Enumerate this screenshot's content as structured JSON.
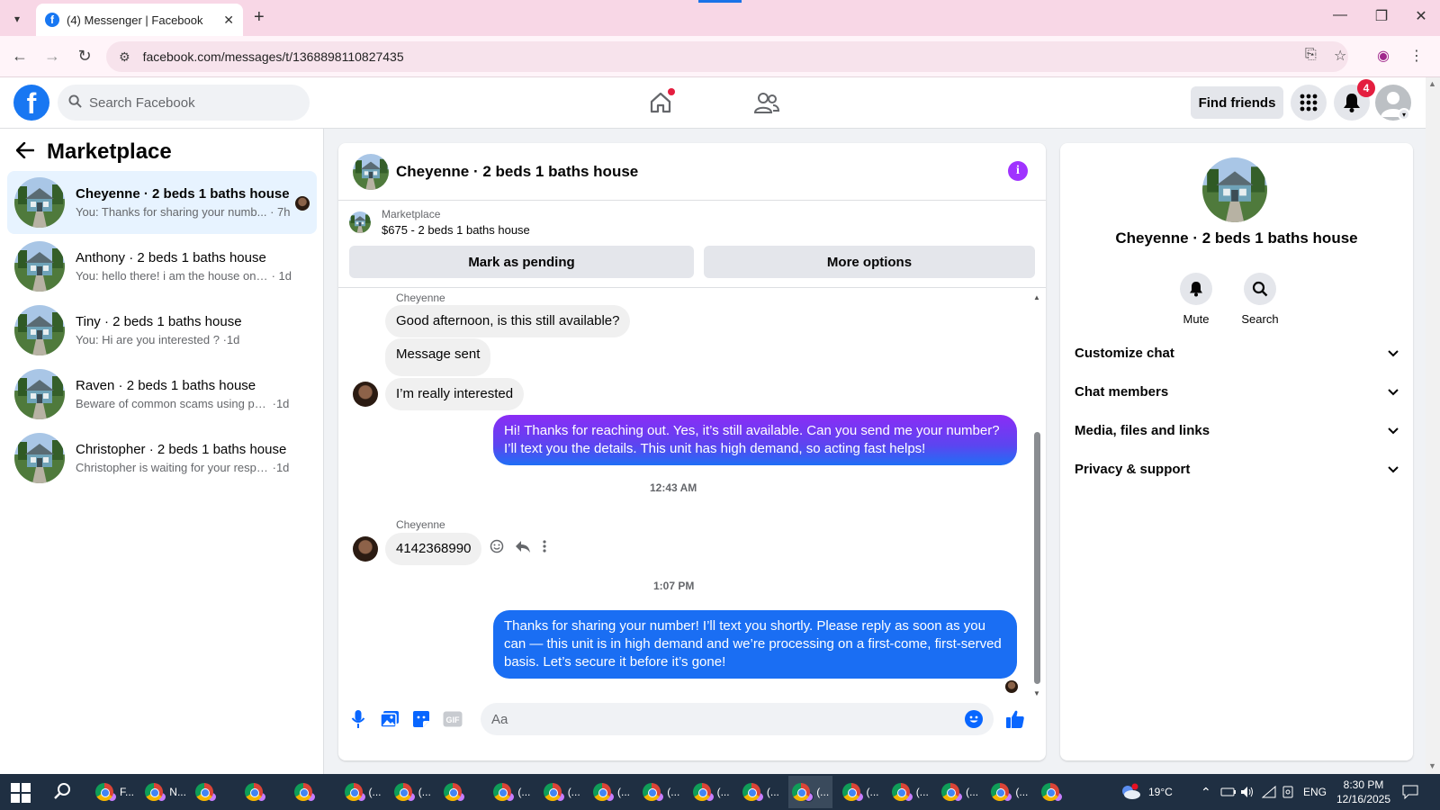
{
  "browser": {
    "tab_title": "(4) Messenger | Facebook",
    "url": "facebook.com/messages/t/1368898110827435"
  },
  "fb": {
    "search_placeholder": "Search Facebook",
    "find_friends": "Find friends",
    "notif_count": "4"
  },
  "sidebar": {
    "title": "Marketplace",
    "conversations": [
      {
        "name": "Cheyenne · 2 beds 1 baths house",
        "snippet": "You: Thanks for sharing your numb...",
        "time": "7h",
        "active": true
      },
      {
        "name": "Anthony · 2 beds 1 baths house",
        "snippet": "You: hello there! i am the house onwe...",
        "time": "1d"
      },
      {
        "name": "Tiny · 2 beds 1 baths house",
        "snippet": "You: Hi are you interested ?",
        "time": "1d"
      },
      {
        "name": "Raven · 2 beds 1 baths house",
        "snippet": "Beware of common scams using pay...",
        "time": "1d"
      },
      {
        "name": "Christopher · 2 beds 1 baths house",
        "snippet": "Christopher is waiting for your respon...",
        "time": "1d"
      }
    ]
  },
  "chat": {
    "title": "Cheyenne · 2 beds 1 baths house",
    "listing_source": "Marketplace",
    "listing_price": "$675 - 2 beds 1 baths house",
    "mark_pending": "Mark as pending",
    "more_options": "More options",
    "sender1": "Cheyenne",
    "msg1": "Good afternoon, is this still available?",
    "msg2": "Message sent",
    "msg3": "I’m really interested",
    "out1": "Hi! Thanks for reaching out. Yes, it’s still available. Can you send me your number? I’ll text you the details. This unit has high demand, so acting fast helps!",
    "time1": "12:43 AM",
    "sender2": "Cheyenne",
    "msg4": "4142368990",
    "time2": "1:07 PM",
    "out2": "Thanks for sharing your number! I’ll text you shortly. Please reply as soon as you can — this unit is in high demand and we’re processing on a first-come, first-served basis. Let’s secure it before it’s gone!",
    "composer_placeholder": "Aa"
  },
  "rpanel": {
    "title": "Cheyenne · 2 beds 1 baths house",
    "mute": "Mute",
    "search": "Search",
    "sections": [
      "Customize chat",
      "Chat members",
      "Media, files and links",
      "Privacy & support"
    ]
  },
  "taskbar": {
    "apps": [
      {
        "label": "F..."
      },
      {
        "label": "N..."
      },
      {
        "label": ""
      },
      {
        "label": ""
      },
      {
        "label": ""
      },
      {
        "label": "(..."
      },
      {
        "label": "(..."
      },
      {
        "label": ""
      },
      {
        "label": "(..."
      },
      {
        "label": "(..."
      },
      {
        "label": "(..."
      },
      {
        "label": "(..."
      },
      {
        "label": "(..."
      },
      {
        "label": "(..."
      },
      {
        "label": "(..."
      },
      {
        "label": "(..."
      },
      {
        "label": "(..."
      },
      {
        "label": "(..."
      },
      {
        "label": "(..."
      },
      {
        "label": ""
      }
    ],
    "temp": "19°C",
    "lang": "ENG",
    "time": "8:30 PM",
    "date": "12/16/2025"
  }
}
